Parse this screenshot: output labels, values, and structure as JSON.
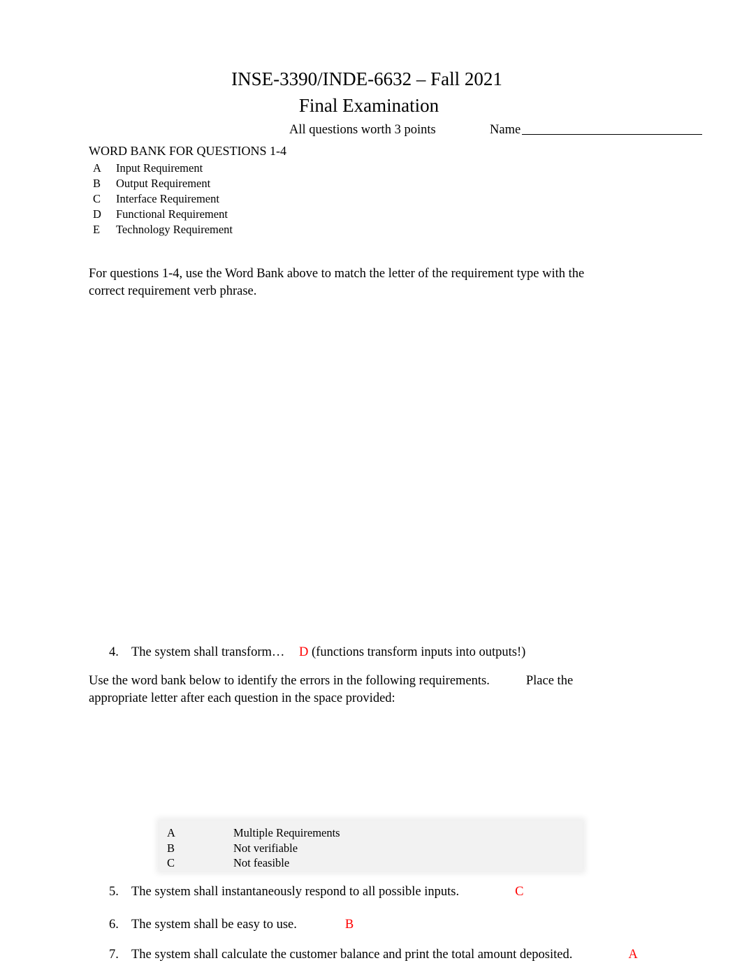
{
  "header": {
    "course_title": "INSE-3390/INDE-6632 – Fall 2021",
    "exam_title": "Final Examination",
    "points_note": "All questions worth 3 points",
    "name_label": "Name"
  },
  "word_bank_1": {
    "heading": "WORD BANK FOR QUESTIONS 1-4",
    "items": [
      {
        "letter": "A",
        "label": "Input Requirement"
      },
      {
        "letter": "B",
        "label": "Output Requirement"
      },
      {
        "letter": "C",
        "label": "Interface Requirement"
      },
      {
        "letter": "D",
        "label": "Functional Requirement"
      },
      {
        "letter": "E",
        "label": "Technology Requirement"
      }
    ]
  },
  "instructions_1": "For questions 1-4, use the Word Bank above to match the letter of the requirement type with the correct requirement verb phrase.",
  "questions_part1": [
    {
      "number": "4.",
      "text": "The system shall transform…",
      "answer": "D",
      "note": "(functions transform inputs into outputs!)"
    }
  ],
  "instructions_2": {
    "part_a": "Use the word bank below to identify the errors in the following requirements.",
    "part_b": "Place the appropriate letter after each question in the space provided:"
  },
  "word_bank_2": {
    "items": [
      {
        "letter": "A",
        "label": "Multiple Requirements"
      },
      {
        "letter": "B",
        "label": "Not verifiable"
      },
      {
        "letter": "C",
        "label": "Not feasible"
      }
    ]
  },
  "questions_part2": [
    {
      "number": "5.",
      "text": "The system shall instantaneously respond to all possible inputs.",
      "answer": "C"
    },
    {
      "number": "6.",
      "text": "The system shall be easy to use.",
      "answer": "B"
    },
    {
      "number": "7.",
      "text": "The system shall calculate the customer balance and print the total amount deposited.",
      "answer": "A"
    }
  ],
  "colors": {
    "answer": "#ff0000",
    "text": "#000000",
    "table_shade": "#f2f2f2"
  }
}
